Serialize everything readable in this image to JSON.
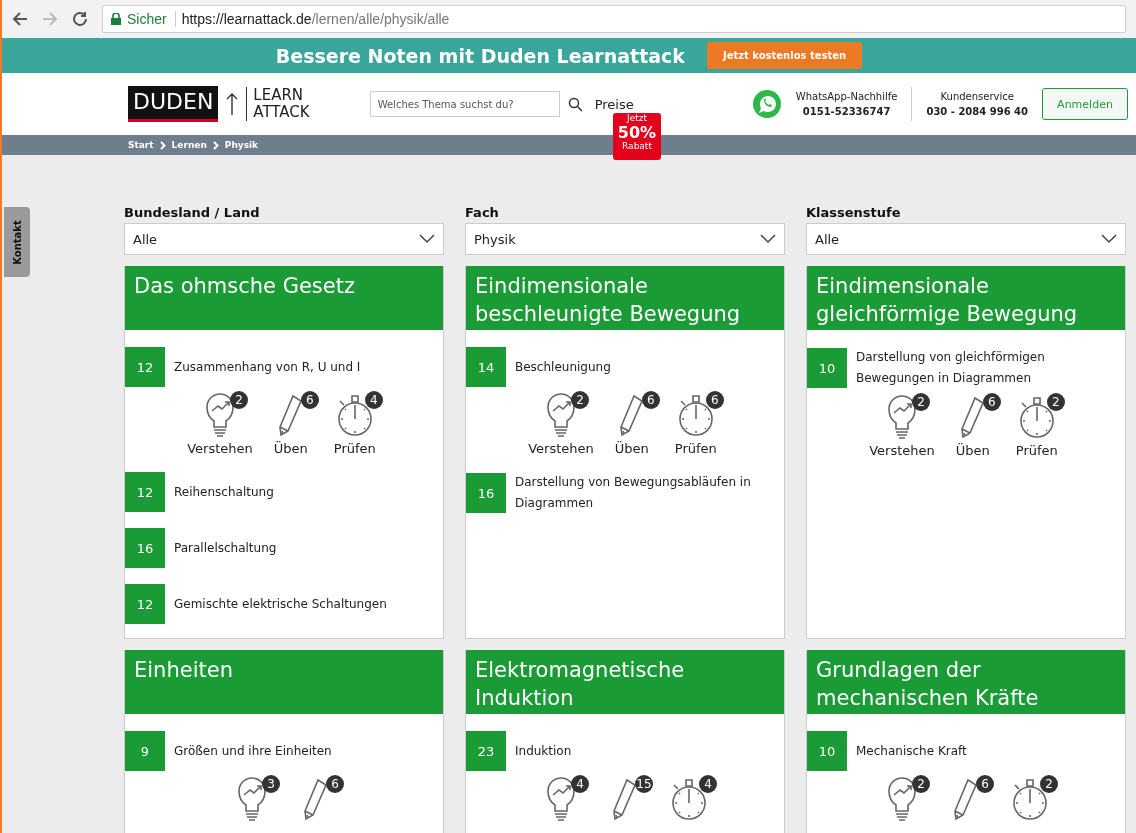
{
  "browser": {
    "security": "Sicher",
    "url_host": "https://learnattack.de",
    "url_path": "/lernen/alle/physik/alle"
  },
  "promo": {
    "text": "Bessere Noten mit Duden Learnattack",
    "button": "Jetzt kostenlos testen"
  },
  "header": {
    "logo_left": "DUDEN",
    "logo_right_1": "LEARN",
    "logo_right_2": "ATTACK",
    "search": {
      "placeholder": "Welches Thema suchst du?"
    },
    "prices": "Preise",
    "discount": {
      "top": "Jetzt",
      "value": "50%",
      "bottom": "Rabatt"
    },
    "whatsapp": {
      "label": "WhatsApp-Nachhilfe",
      "number": "0151-52336747"
    },
    "service": {
      "label": "Kundenservice",
      "number": "030 - 2084 996 40"
    },
    "login": "Anmelden"
  },
  "breadcrumb": [
    "Start",
    "Lernen",
    "Physik"
  ],
  "contact_tab": "Kontakt",
  "filters": [
    {
      "label": "Bundesland / Land",
      "value": "Alle"
    },
    {
      "label": "Fach",
      "value": "Physik"
    },
    {
      "label": "Klassenstufe",
      "value": "Alle"
    }
  ],
  "cards": [
    {
      "title": "Das ohmsche Gesetz",
      "topics": [
        {
          "number": "12",
          "title": "Zusammenhang von R, U und I",
          "activities": [
            {
              "kind": "understand",
              "count": "2",
              "label": "Verstehen"
            },
            {
              "kind": "practice",
              "count": "6",
              "label": "Üben"
            },
            {
              "kind": "test",
              "count": "4",
              "label": "Prüfen"
            }
          ]
        },
        {
          "number": "12",
          "title": "Reihenschaltung"
        },
        {
          "number": "16",
          "title": "Parallelschaltung"
        },
        {
          "number": "12",
          "title": "Gemischte elektrische Schaltungen"
        }
      ]
    },
    {
      "title": "Eindimensionale beschleunigte Bewegung",
      "topics": [
        {
          "number": "14",
          "title": "Beschleunigung",
          "activities": [
            {
              "kind": "understand",
              "count": "2",
              "label": "Verstehen"
            },
            {
              "kind": "practice",
              "count": "6",
              "label": "Üben"
            },
            {
              "kind": "test",
              "count": "6",
              "label": "Prüfen"
            }
          ]
        },
        {
          "number": "16",
          "title": "Darstellung von Bewegungsabläufen in Diagrammen"
        }
      ]
    },
    {
      "title": "Eindimensionale gleichförmige Bewegung",
      "topics": [
        {
          "number": "10",
          "title": "Darstellung von gleichförmigen Bewegungen in Diagrammen",
          "activities": [
            {
              "kind": "understand",
              "count": "2",
              "label": "Verstehen"
            },
            {
              "kind": "practice",
              "count": "6",
              "label": "Üben"
            },
            {
              "kind": "test",
              "count": "2",
              "label": "Prüfen"
            }
          ]
        }
      ]
    },
    {
      "title": "Einheiten",
      "topics": [
        {
          "number": "9",
          "title": "Größen und ihre Einheiten",
          "activities": [
            {
              "kind": "understand",
              "count": "3"
            },
            {
              "kind": "practice",
              "count": "6"
            }
          ]
        }
      ]
    },
    {
      "title": "Elektromagnetische Induktion",
      "topics": [
        {
          "number": "23",
          "title": "Induktion",
          "activities": [
            {
              "kind": "understand",
              "count": "4"
            },
            {
              "kind": "practice",
              "count": "15"
            },
            {
              "kind": "test",
              "count": "4"
            }
          ]
        }
      ]
    },
    {
      "title": "Grundlagen der mechanischen Kräfte",
      "topics": [
        {
          "number": "10",
          "title": "Mechanische Kraft",
          "activities": [
            {
              "kind": "understand",
              "count": "2"
            },
            {
              "kind": "practice",
              "count": "6"
            },
            {
              "kind": "test",
              "count": "2"
            }
          ]
        }
      ]
    }
  ]
}
